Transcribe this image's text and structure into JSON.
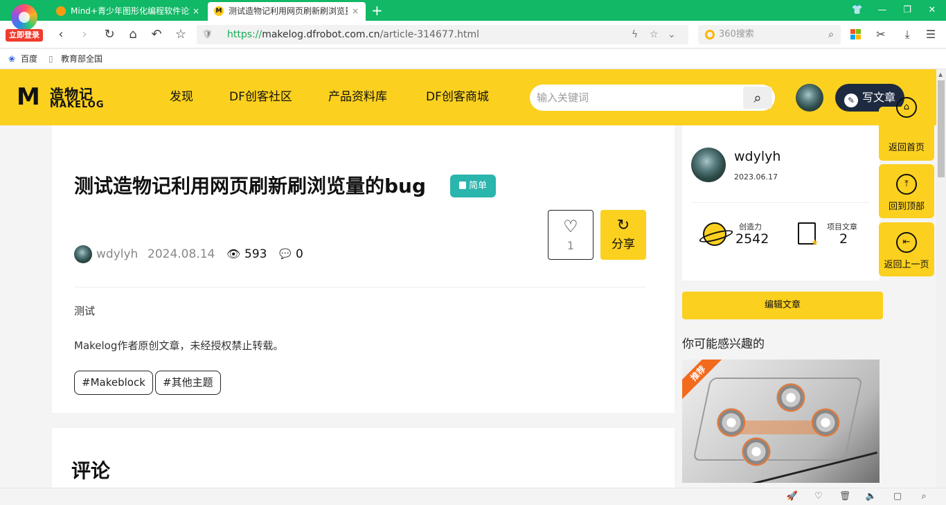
{
  "browser": {
    "login_label": "立即登录",
    "tabs": [
      {
        "title": "Mind+青少年图形化编程软件论坛",
        "close": "×"
      },
      {
        "title": "测试造物记利用网页刷新刷浏览量的bug - Makelog",
        "close": "×"
      }
    ],
    "new_tab": "+",
    "url_prefix": "https://",
    "url_domain": "makelog.dfrobot.com.cn",
    "url_path": "/article-314677.html",
    "search_placeholder": "360搜索",
    "bookmarks": [
      {
        "label": "百度"
      },
      {
        "label": "教育部全国"
      }
    ]
  },
  "site": {
    "logo_cn": "造物记",
    "logo_en": "MAKELOG",
    "nav": [
      "发现",
      "DF创客社区",
      "产品资料库",
      "DF创客商城"
    ],
    "search_placeholder": "输入关键词",
    "write_label": "写文章"
  },
  "article": {
    "title": "测试造物记利用网页刷新刷浏览量的bug",
    "difficulty": "简单",
    "author": "wdylyh",
    "date": "2024.08.14",
    "views": "593",
    "comments": "0",
    "likes": "1",
    "share_label": "分享",
    "body": [
      "测试",
      "Makelog作者原创文章，未经授权禁止转载。"
    ],
    "tags": [
      "#Makeblock",
      "#其他主题"
    ]
  },
  "comments_section": {
    "title": "评论"
  },
  "sidebar": {
    "profile": {
      "name": "wdylyh",
      "joined": "2023.06.17",
      "creativity_label": "创造力",
      "creativity_value": "2542",
      "projects_label": "项目文章",
      "projects_value": "2"
    },
    "edit_label": "编辑文章",
    "interest_title": "你可能感兴趣的",
    "recommend_badge": "推荐"
  },
  "floating": {
    "home": "返回首页",
    "top": "回到顶部",
    "back": "返回上一页"
  }
}
